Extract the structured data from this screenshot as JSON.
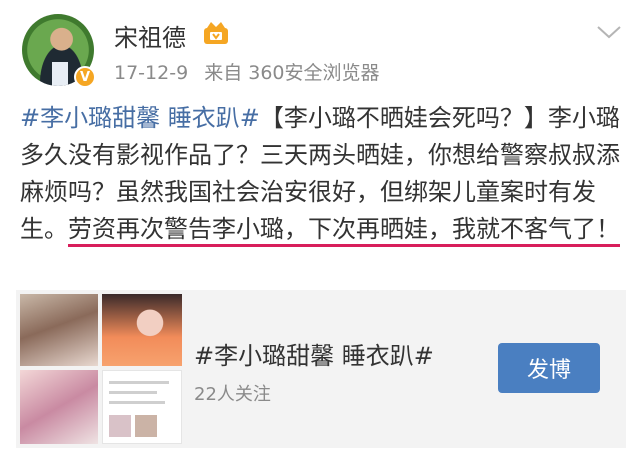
{
  "header": {
    "username": "宋祖德",
    "verified_badge": "V",
    "icons": [
      "vip-crown-icon",
      "chevron-down-icon",
      "verified-badge-icon"
    ],
    "timestamp": "17-12-9",
    "source": "来自 360安全浏览器"
  },
  "post": {
    "tag": "#李小璐甜馨 睡衣趴#",
    "text1": "【李小璐不晒娃会死吗？】李小璐多久没有影视作品了？三天两头晒娃，你想给警察叔叔添麻烦吗？虽然我国社会治安很好，但绑架儿童案时有发生。",
    "text_underlined": "劳资再次警告李小璐，下次再晒娃，我就不客气了！"
  },
  "topic_card": {
    "title": "#李小璐甜馨 睡衣趴#",
    "followers": "22人关注",
    "button_label": "发博"
  },
  "colors": {
    "link": "#476ea4",
    "underline": "#d81e5b",
    "button": "#4a7fc1",
    "card_bg": "#f3f3f3",
    "meta_text": "#8a8a8a"
  }
}
